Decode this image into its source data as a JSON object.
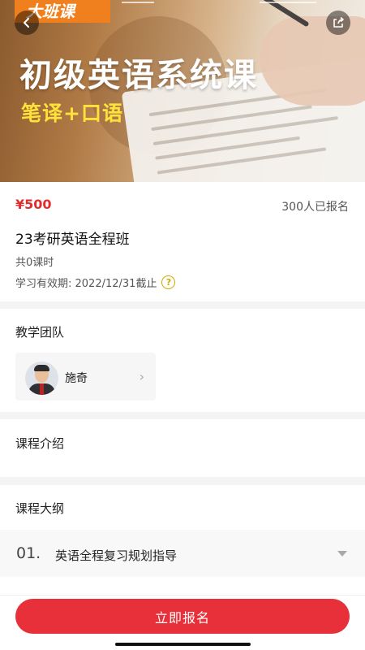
{
  "hero": {
    "badge": "大班课",
    "title": "初级英语系统课",
    "subtitle": "笔译+口语"
  },
  "course": {
    "price": "¥500",
    "enrolled": "300人已报名",
    "title": "23考研英语全程班",
    "lessons": "共0课时",
    "validity": "学习有效期: 2022/12/31截止"
  },
  "team": {
    "section_title": "教学团队",
    "teacher_name": "施奇"
  },
  "intro": {
    "section_title": "课程介绍"
  },
  "outline": {
    "section_title": "课程大纲",
    "chapters": [
      {
        "number": "01.",
        "title": "英语全程复习规划指导"
      }
    ]
  },
  "actions": {
    "enroll_label": "立即报名"
  },
  "colors": {
    "accent": "#e8303a",
    "price": "#e02d2d",
    "badge": "#f07f1d",
    "subtitle": "#ffe23a"
  }
}
